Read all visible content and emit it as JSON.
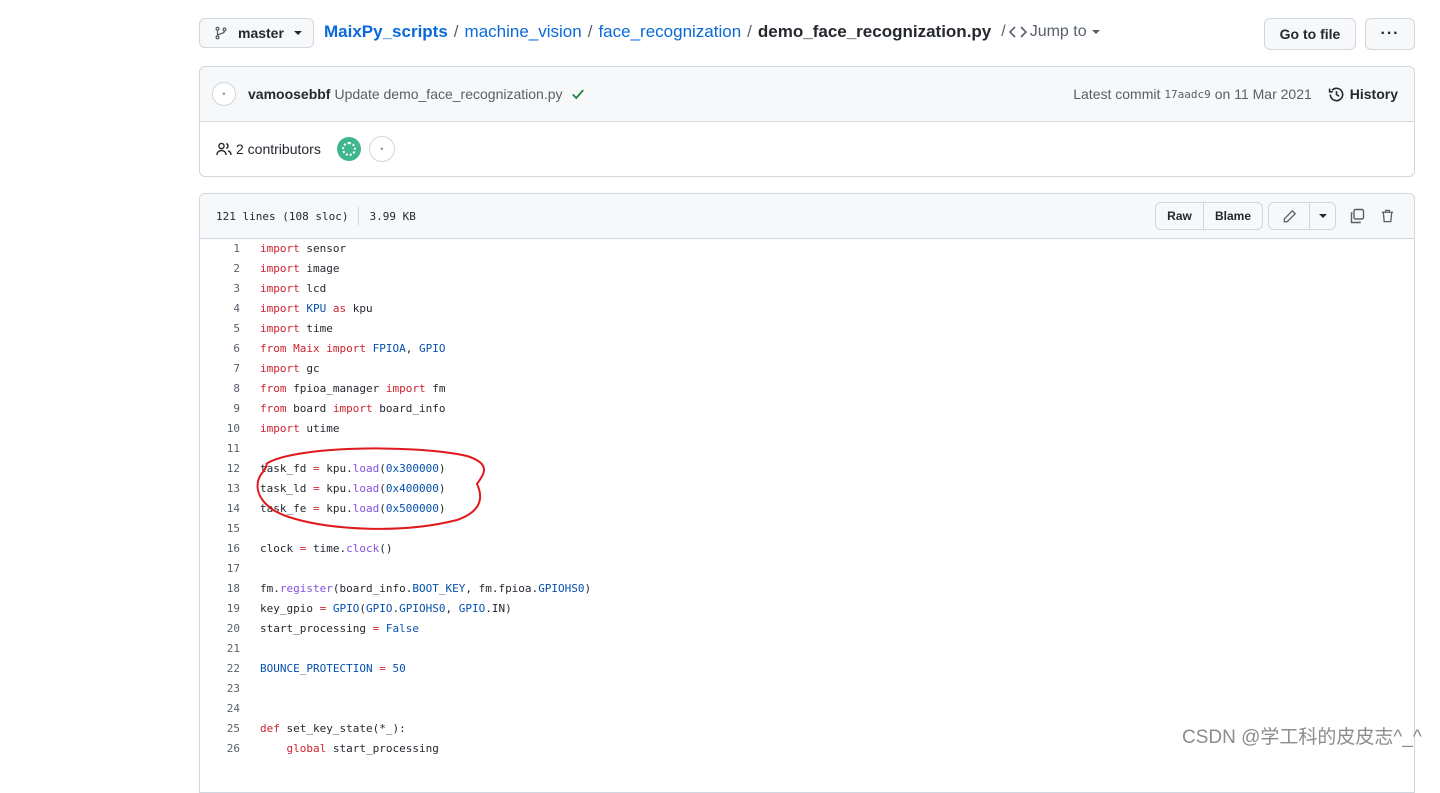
{
  "branch": {
    "label": "master"
  },
  "breadcrumb": {
    "items": [
      "MaixPy_scripts",
      "machine_vision",
      "face_recognization"
    ],
    "current": "demo_face_recognization.py",
    "jump_label": "Jump to"
  },
  "buttons": {
    "go_to_file": "Go to file",
    "more": "···"
  },
  "commit": {
    "author": "vamoosebbf",
    "message": "Update demo_face_recognization.py",
    "latest_label": "Latest commit",
    "sha": "17aadc9",
    "date": "on 11 Mar 2021",
    "history_label": "History"
  },
  "contributors": {
    "label": "2 contributors"
  },
  "file": {
    "lines_info": "121 lines (108 sloc)",
    "size": "3.99 KB",
    "raw_label": "Raw",
    "blame_label": "Blame"
  },
  "code_lines": [
    {
      "n": "1",
      "t": "import sensor"
    },
    {
      "n": "2",
      "t": "import image"
    },
    {
      "n": "3",
      "t": "import lcd"
    },
    {
      "n": "4",
      "t": "import KPU as kpu"
    },
    {
      "n": "5",
      "t": "import time"
    },
    {
      "n": "6",
      "t": "from Maix import FPIOA, GPIO"
    },
    {
      "n": "7",
      "t": "import gc"
    },
    {
      "n": "8",
      "t": "from fpioa_manager import fm"
    },
    {
      "n": "9",
      "t": "from board import board_info"
    },
    {
      "n": "10",
      "t": "import utime"
    },
    {
      "n": "11",
      "t": ""
    },
    {
      "n": "12",
      "t": "task_fd = kpu.load(0x300000)"
    },
    {
      "n": "13",
      "t": "task_ld = kpu.load(0x400000)"
    },
    {
      "n": "14",
      "t": "task_fe = kpu.load(0x500000)"
    },
    {
      "n": "15",
      "t": ""
    },
    {
      "n": "16",
      "t": "clock = time.clock()"
    },
    {
      "n": "17",
      "t": ""
    },
    {
      "n": "18",
      "t": "fm.register(board_info.BOOT_KEY, fm.fpioa.GPIOHS0)"
    },
    {
      "n": "19",
      "t": "key_gpio = GPIO(GPIO.GPIOHS0, GPIO.IN)"
    },
    {
      "n": "20",
      "t": "start_processing = False"
    },
    {
      "n": "21",
      "t": ""
    },
    {
      "n": "22",
      "t": "BOUNCE_PROTECTION = 50"
    },
    {
      "n": "23",
      "t": ""
    },
    {
      "n": "24",
      "t": ""
    },
    {
      "n": "25",
      "t": "def set_key_state(*_):"
    },
    {
      "n": "26",
      "t": "    global start_processing"
    }
  ],
  "watermark": "CSDN @学工科的皮皮志^_^",
  "colors": {
    "link": "#0969da",
    "keyword": "#cf222e",
    "function": "#8250df",
    "constant": "#0550ae",
    "annotation": "#e0191d"
  }
}
